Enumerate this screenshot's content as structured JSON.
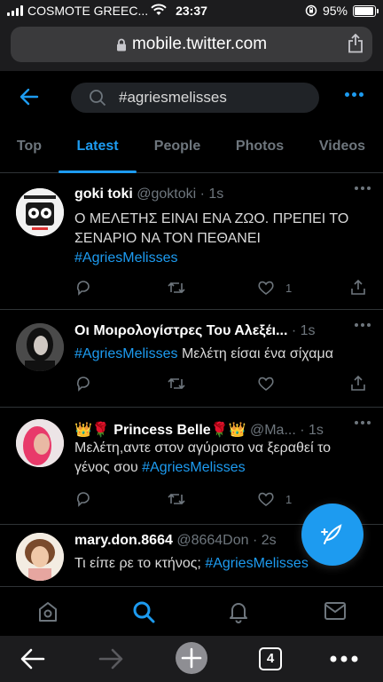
{
  "status_bar": {
    "carrier": "COSMOTE GREEC...",
    "time": "23:37",
    "battery": "95%",
    "battery_level": 0.95
  },
  "browser": {
    "url": "mobile.twitter.com",
    "tab_count": "4"
  },
  "search": {
    "query": "#agriesmelisses"
  },
  "tabs": [
    "Top",
    "Latest",
    "People",
    "Photos",
    "Videos"
  ],
  "active_tab": "Latest",
  "tweets": [
    {
      "name": "goki toki",
      "handle": "@goktoki",
      "time": "1s",
      "text": "Ο ΜΕΛΕΤΗΣ ΕΙΝΑΙ ΕΝΑ ΖΩΟ. ΠΡΕΠΕΙ ΤΟ ΣΕΝΑΡΙΟ ΝΑ ΤΟΝ ΠΕΘΑΝΕΙ",
      "hashtag": "#AgriesMelisses",
      "likes": "1"
    },
    {
      "name": "Οι Μοιρολογίστρες Του Αλεξέι...",
      "handle": "",
      "time": "1s",
      "hashtag": "#AgriesMelisses",
      "text": "Μελέτη είσαι ένα σίχαμα",
      "likes": ""
    },
    {
      "name": "👑🌹 Princess Belle🌹👑",
      "handle": "@Ma...",
      "time": "1s",
      "text": "Μελέτη,αντε στον αγύριστο να ξεραθεί το γένος σου",
      "hashtag": "#AgriesMelisses",
      "likes": "1"
    },
    {
      "name": "mary.don.8664",
      "handle": "@8664Don",
      "time": "2s",
      "text": "Τι είπε ρε το κτήνος;",
      "hashtag": "#AgriesMelisses",
      "likes": ""
    }
  ],
  "colors": {
    "accent": "#1d9bf0",
    "muted": "#6e767d",
    "background": "#000000"
  },
  "icons": {
    "bottom_nav": [
      "home-icon",
      "search-icon",
      "notifications-icon",
      "messages-icon"
    ],
    "safari_toolbar": [
      "back-arrow-icon",
      "forward-arrow-icon",
      "new-tab-plus-icon",
      "tabs-icon",
      "more-icon"
    ]
  }
}
